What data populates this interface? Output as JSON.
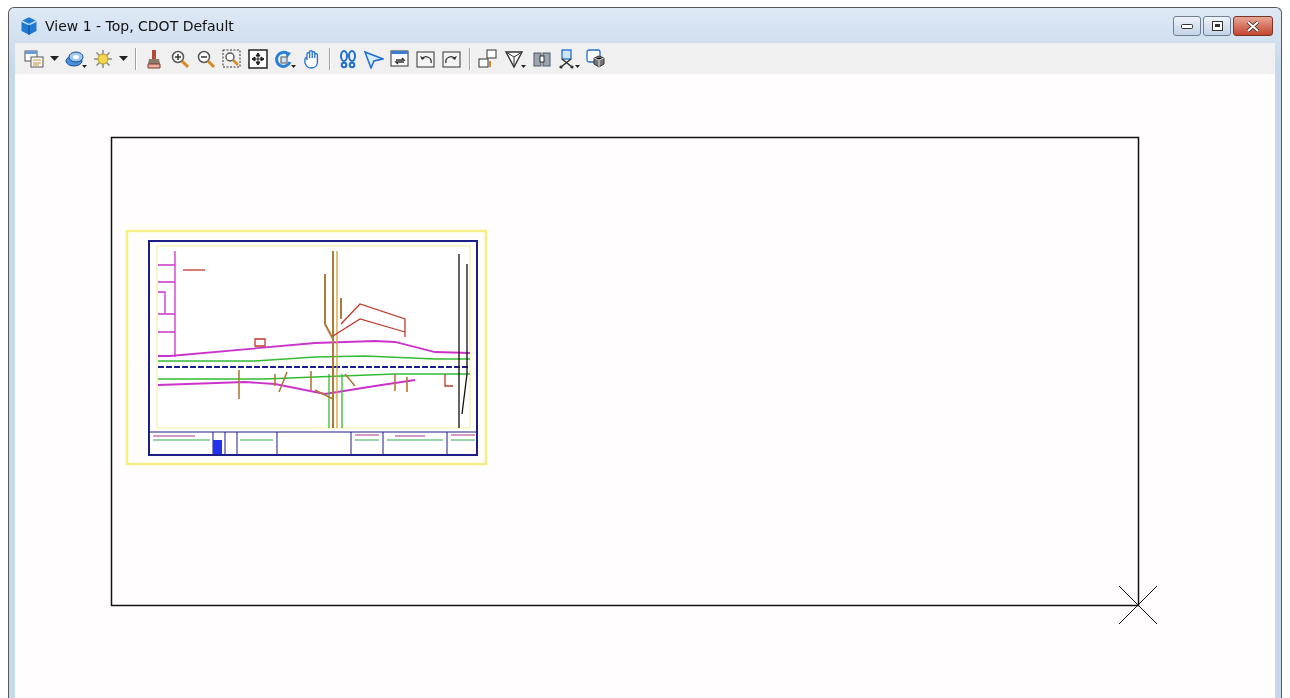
{
  "window": {
    "title": "View 1 - Top, CDOT Default"
  },
  "toolbar": {
    "groups": [
      {
        "items": [
          {
            "kind": "split"
          },
          {
            "kind": "flyout"
          },
          {
            "kind": "split"
          }
        ]
      },
      {
        "items": [
          {
            "kind": "plain"
          },
          {
            "kind": "plain"
          },
          {
            "kind": "plain"
          },
          {
            "kind": "plain"
          },
          {
            "kind": "plain"
          },
          {
            "kind": "flyout"
          },
          {
            "kind": "plain"
          }
        ]
      },
      {
        "items": [
          {
            "kind": "plain"
          },
          {
            "kind": "plain"
          },
          {
            "kind": "plain"
          },
          {
            "kind": "plain"
          },
          {
            "kind": "plain"
          }
        ]
      },
      {
        "items": [
          {
            "kind": "plain"
          },
          {
            "kind": "flyout"
          },
          {
            "kind": "plain"
          },
          {
            "kind": "flyout"
          },
          {
            "kind": "plain"
          }
        ]
      }
    ]
  }
}
